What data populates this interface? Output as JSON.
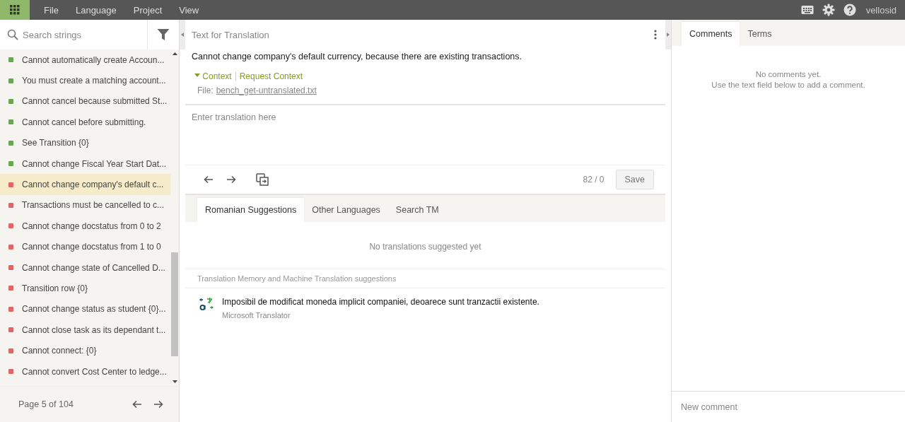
{
  "topbar": {
    "menu": [
      "File",
      "Language",
      "Project",
      "View"
    ],
    "user": "vellosid"
  },
  "sidebar": {
    "search": {
      "placeholder": "Search strings"
    },
    "strings": [
      {
        "text": "Cannot automatically create Accoun...",
        "color": "#6aa84f",
        "selected": false
      },
      {
        "text": "You must create a matching account...",
        "color": "#6aa84f",
        "selected": false
      },
      {
        "text": "Cannot cancel because submitted St...",
        "color": "#6aa84f",
        "selected": false
      },
      {
        "text": "Cannot cancel before submitting.",
        "color": "#6aa84f",
        "selected": false
      },
      {
        "text": "See Transition {0}",
        "color": "#6aa84f",
        "selected": false
      },
      {
        "text": "Cannot change Fiscal Year Start Dat...",
        "color": "#6aa84f",
        "selected": false
      },
      {
        "text": "Cannot change company's default c...",
        "color": "#e06666",
        "selected": true
      },
      {
        "text": "Transactions must be cancelled to c...",
        "color": "#e06666",
        "selected": false
      },
      {
        "text": "Cannot change docstatus from 0 to 2",
        "color": "#e06666",
        "selected": false
      },
      {
        "text": "Cannot change docstatus from 1 to 0",
        "color": "#e06666",
        "selected": false
      },
      {
        "text": "Cannot change state of Cancelled D...",
        "color": "#e06666",
        "selected": false
      },
      {
        "text": "Transition row {0}",
        "color": "#e06666",
        "selected": false
      },
      {
        "text": "Cannot change status as student {0}...",
        "color": "#e06666",
        "selected": false
      },
      {
        "text": "Cannot close task as its dependant t...",
        "color": "#e06666",
        "selected": false
      },
      {
        "text": "Cannot connect: {0}",
        "color": "#e06666",
        "selected": false
      },
      {
        "text": "Cannot convert Cost Center to ledge...",
        "color": "#e06666",
        "selected": false
      }
    ],
    "pager": {
      "label": "Page 5 of 104"
    }
  },
  "editor": {
    "title": "Text for Translation",
    "source": "Cannot change company's default currency, because there are existing transactions.",
    "context": {
      "label": "Context",
      "expanded": true
    },
    "request_context": "Request Context",
    "file": {
      "label": "File:",
      "name": "bench_get-untranslated.txt"
    },
    "translation": {
      "placeholder": "Enter translation here"
    },
    "counter": "82 / 0",
    "save": "Save"
  },
  "suggestions": {
    "tabs": [
      {
        "label": "Romanian Suggestions",
        "selected": true
      },
      {
        "label": "Other Languages",
        "selected": false
      },
      {
        "label": "Search TM",
        "selected": false
      }
    ],
    "empty": "No translations suggested yet",
    "section_title": "Translation Memory and Machine Translation suggestions",
    "items": [
      {
        "text": "Imposibil de modificat moneda implicit companiei, deoarece sunt tranzactii existente.",
        "source": "Microsoft Translator"
      }
    ]
  },
  "comments": {
    "tabs": [
      {
        "label": "Comments",
        "selected": true
      },
      {
        "label": "Terms",
        "selected": false
      }
    ],
    "empty": [
      "No comments yet.",
      "Use the text field below to add a comment."
    ],
    "new_comment": {
      "placeholder": "New comment"
    }
  }
}
